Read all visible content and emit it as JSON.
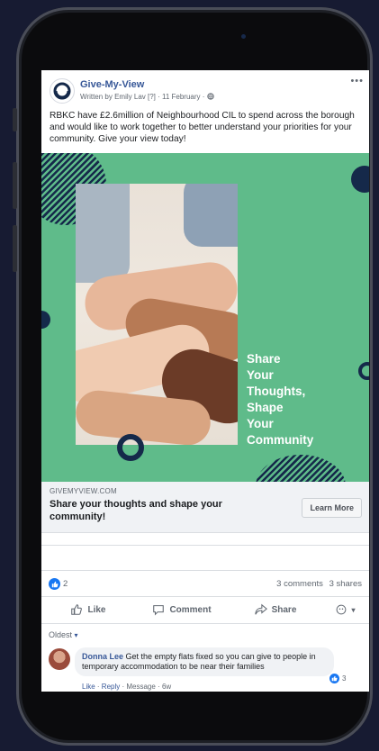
{
  "post": {
    "page_name": "Give-My-View",
    "meta": "Written by Emily Lav [?] · 11 February · ",
    "more_icon": "more-dots-icon",
    "text": "RBKC have £2.6million of Neighbourhood CIL to spend across the borough and would like to work together to better understand your priorities for your community. Give your view today!"
  },
  "hero": {
    "tagline_lines": [
      "Share",
      "Your",
      "Thoughts,",
      "Shape",
      "Your",
      "Community"
    ],
    "background_color": "#5fbb8a",
    "accent_color": "#15294a"
  },
  "link_preview": {
    "domain": "GIVEMYVIEW.COM",
    "title": "Share your thoughts and shape your community!",
    "button_label": "Learn More"
  },
  "engagement": {
    "reaction_count": "2",
    "comments": "3 comments",
    "shares": "3 shares"
  },
  "actions": {
    "like": "Like",
    "comment": "Comment",
    "share": "Share"
  },
  "comments": {
    "sort_label": "Oldest",
    "items": [
      {
        "author": "Donna Lee",
        "text": "Get the empty flats fixed so you can give to people in temporary accommodation to be near their families",
        "like_count": "3",
        "like": "Like",
        "reply": "Reply",
        "message": "Message",
        "age": "6w"
      }
    ]
  },
  "colors": {
    "brand_link": "#385898",
    "facebook_blue": "#1877f2"
  }
}
